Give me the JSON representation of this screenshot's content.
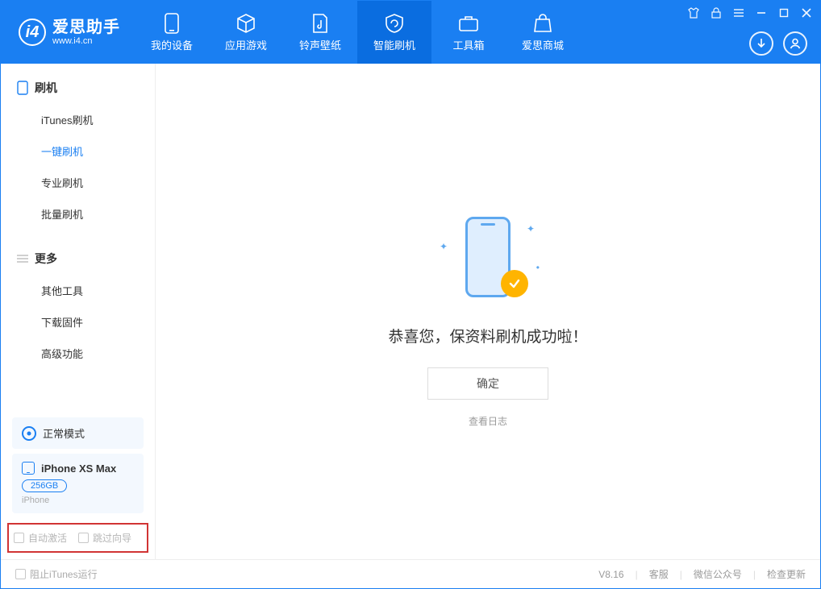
{
  "brand": {
    "title": "爱思助手",
    "url": "www.i4.cn"
  },
  "header_tabs": {
    "device": "我的设备",
    "apps": "应用游戏",
    "ringtones": "铃声壁纸",
    "flash": "智能刷机",
    "toolbox": "工具箱",
    "store": "爱思商城"
  },
  "sidebar": {
    "section1": {
      "title": "刷机",
      "items": [
        "iTunes刷机",
        "一键刷机",
        "专业刷机",
        "批量刷机"
      ]
    },
    "section2": {
      "title": "更多",
      "items": [
        "其他工具",
        "下载固件",
        "高级功能"
      ]
    },
    "mode_label": "正常模式",
    "device": {
      "name": "iPhone XS Max",
      "storage": "256GB",
      "type": "iPhone"
    },
    "checkbox_auto_activate": "自动激活",
    "checkbox_skip_guide": "跳过向导"
  },
  "main": {
    "success_message": "恭喜您，保资料刷机成功啦！",
    "ok_button": "确定",
    "view_log": "查看日志"
  },
  "footer": {
    "block_itunes": "阻止iTunes运行",
    "version": "V8.16",
    "support": "客服",
    "wechat": "微信公众号",
    "check_update": "检查更新"
  }
}
